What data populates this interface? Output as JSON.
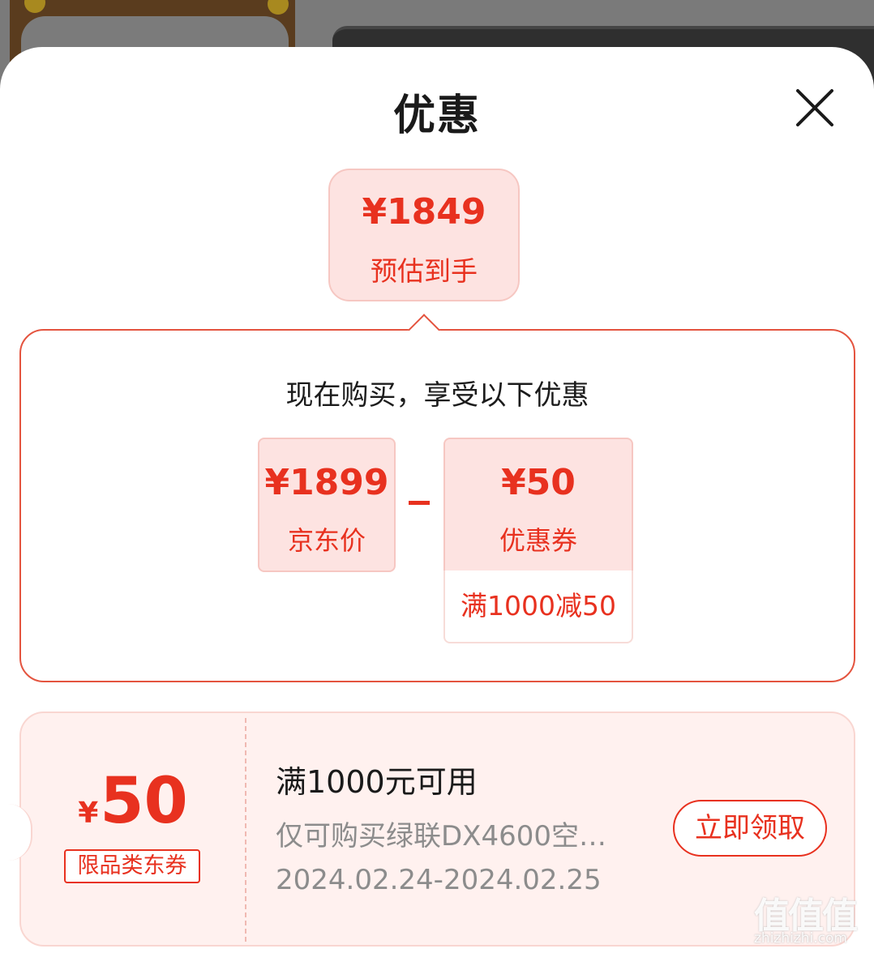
{
  "sheet": {
    "title": "优惠",
    "close_icon": "close-icon"
  },
  "estimate": {
    "price": "¥1849",
    "label": "预估到手"
  },
  "breakdown": {
    "heading": "现在购买，享受以下优惠",
    "jd_price": {
      "value": "¥1899",
      "label": "京东价"
    },
    "operator": "minus",
    "coupon": {
      "value": "¥50",
      "label": "优惠券",
      "condition": "满1000减50"
    }
  },
  "coupon_card": {
    "currency": "¥",
    "amount": "50",
    "tag": "限品类东券",
    "title": "满1000元可用",
    "description": "仅可购买绿联DX4600空…",
    "validity": "2024.02.24-2024.02.25",
    "claim_label": "立即领取"
  },
  "watermark": {
    "url": "zhizhizhi.com"
  },
  "colors": {
    "accent": "#e8311f",
    "accent_light_bg": "#fde3e1",
    "coupon_bg": "#fff1ef"
  }
}
